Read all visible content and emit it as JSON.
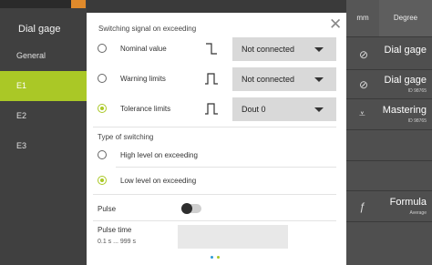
{
  "left_nav": {
    "title": "Dial gage",
    "items": [
      {
        "label": "General",
        "active": false
      },
      {
        "label": "E1",
        "active": true
      },
      {
        "label": "E2",
        "active": false
      },
      {
        "label": "E3",
        "active": false
      }
    ]
  },
  "right_panel": {
    "units": [
      "mm",
      "Degree"
    ],
    "cards": [
      {
        "icon": "dial-gage-icon",
        "title": "Dial gage",
        "subtitle": ""
      },
      {
        "icon": "dial-gage-icon",
        "title": "Dial gage",
        "subtitle": "ID 98765"
      },
      {
        "icon": "mastering-icon",
        "title": "Mastering",
        "subtitle": "ID 98765"
      },
      {
        "icon": "formula-icon",
        "title": "Formula",
        "subtitle": "Average"
      }
    ]
  },
  "dialog": {
    "title": "Switching signal on exceeding",
    "close_icon": "close-icon",
    "signal_rows": [
      {
        "label": "Nominal value",
        "selected": false,
        "signal_icon": "step-signal-icon",
        "value": "Not connected"
      },
      {
        "label": "Warning limits",
        "selected": false,
        "signal_icon": "pulse-signal-icon",
        "value": "Not connected"
      },
      {
        "label": "Tolerance limits",
        "selected": true,
        "signal_icon": "pulse-signal-icon",
        "value": "Dout 0"
      }
    ],
    "switching_type": {
      "title": "Type of switching",
      "options": [
        {
          "label": "High level on exceeding",
          "selected": false
        },
        {
          "label": "Low level on exceeding",
          "selected": true
        }
      ]
    },
    "pulse": {
      "label": "Pulse",
      "enabled": false
    },
    "pulse_time": {
      "label": "Pulse time",
      "range": "0.1 s ... 999 s",
      "value": ""
    },
    "page_count": 2,
    "current_page": 2
  },
  "colors": {
    "accent_green": "#aac826",
    "accent_orange": "#e08a2b",
    "page_dot_inactive": "#2e9bd6"
  }
}
